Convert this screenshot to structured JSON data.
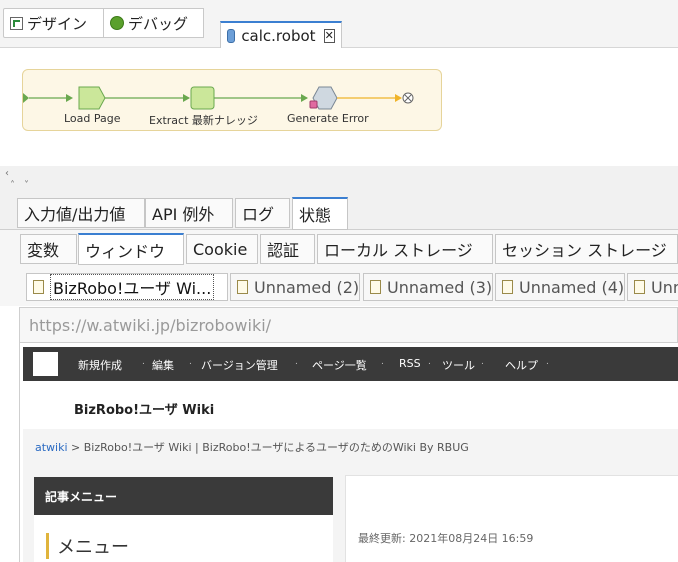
{
  "perspectives": {
    "design_label": "デザイン",
    "debug_label": "デバッグ"
  },
  "editor": {
    "tab_label": "calc.robot",
    "close_symbol": "✕"
  },
  "workflow": {
    "steps": [
      "Load Page",
      "Extract 最新ナレッジ",
      "Generate Error"
    ],
    "colors": {
      "step_fill": "#cbe79a",
      "error_fill": "#cfd8e0",
      "connector": "#6aa84f",
      "end_connector": "#f0b429",
      "canvas": "#fdf7e6"
    }
  },
  "panel_tabs": [
    "入力値/出力値",
    "API 例外",
    "ログ",
    "状態"
  ],
  "state_tabs": [
    "変数",
    "ウィンドウ",
    "Cookie",
    "認証",
    "ローカル ストレージ",
    "セッション ストレージ"
  ],
  "window_tabs": [
    "BizRobo!ユーザ Wi...",
    "Unnamed (2)",
    "Unnamed (3)",
    "Unnamed (4)",
    "Unn"
  ],
  "url": "https://w.atwiki.jp/bizrobowiki/",
  "web": {
    "nav": [
      "新規作成",
      "編集",
      "バージョン管理",
      "ページ一覧",
      "RSS",
      "ツール",
      "ヘルプ"
    ],
    "site_title": "BizRobo!ユーザ Wiki",
    "breadcrumb_link": "atwiki",
    "breadcrumb_rest": " > BizRobo!ユーザ Wiki | BizRobo!ユーザによるユーザのためのWiki  By RBUG",
    "side_menu_header": "記事メニュー",
    "side_menu_title": "メニュー",
    "last_updated": "最終更新:  2021年08月24日  16:59"
  }
}
